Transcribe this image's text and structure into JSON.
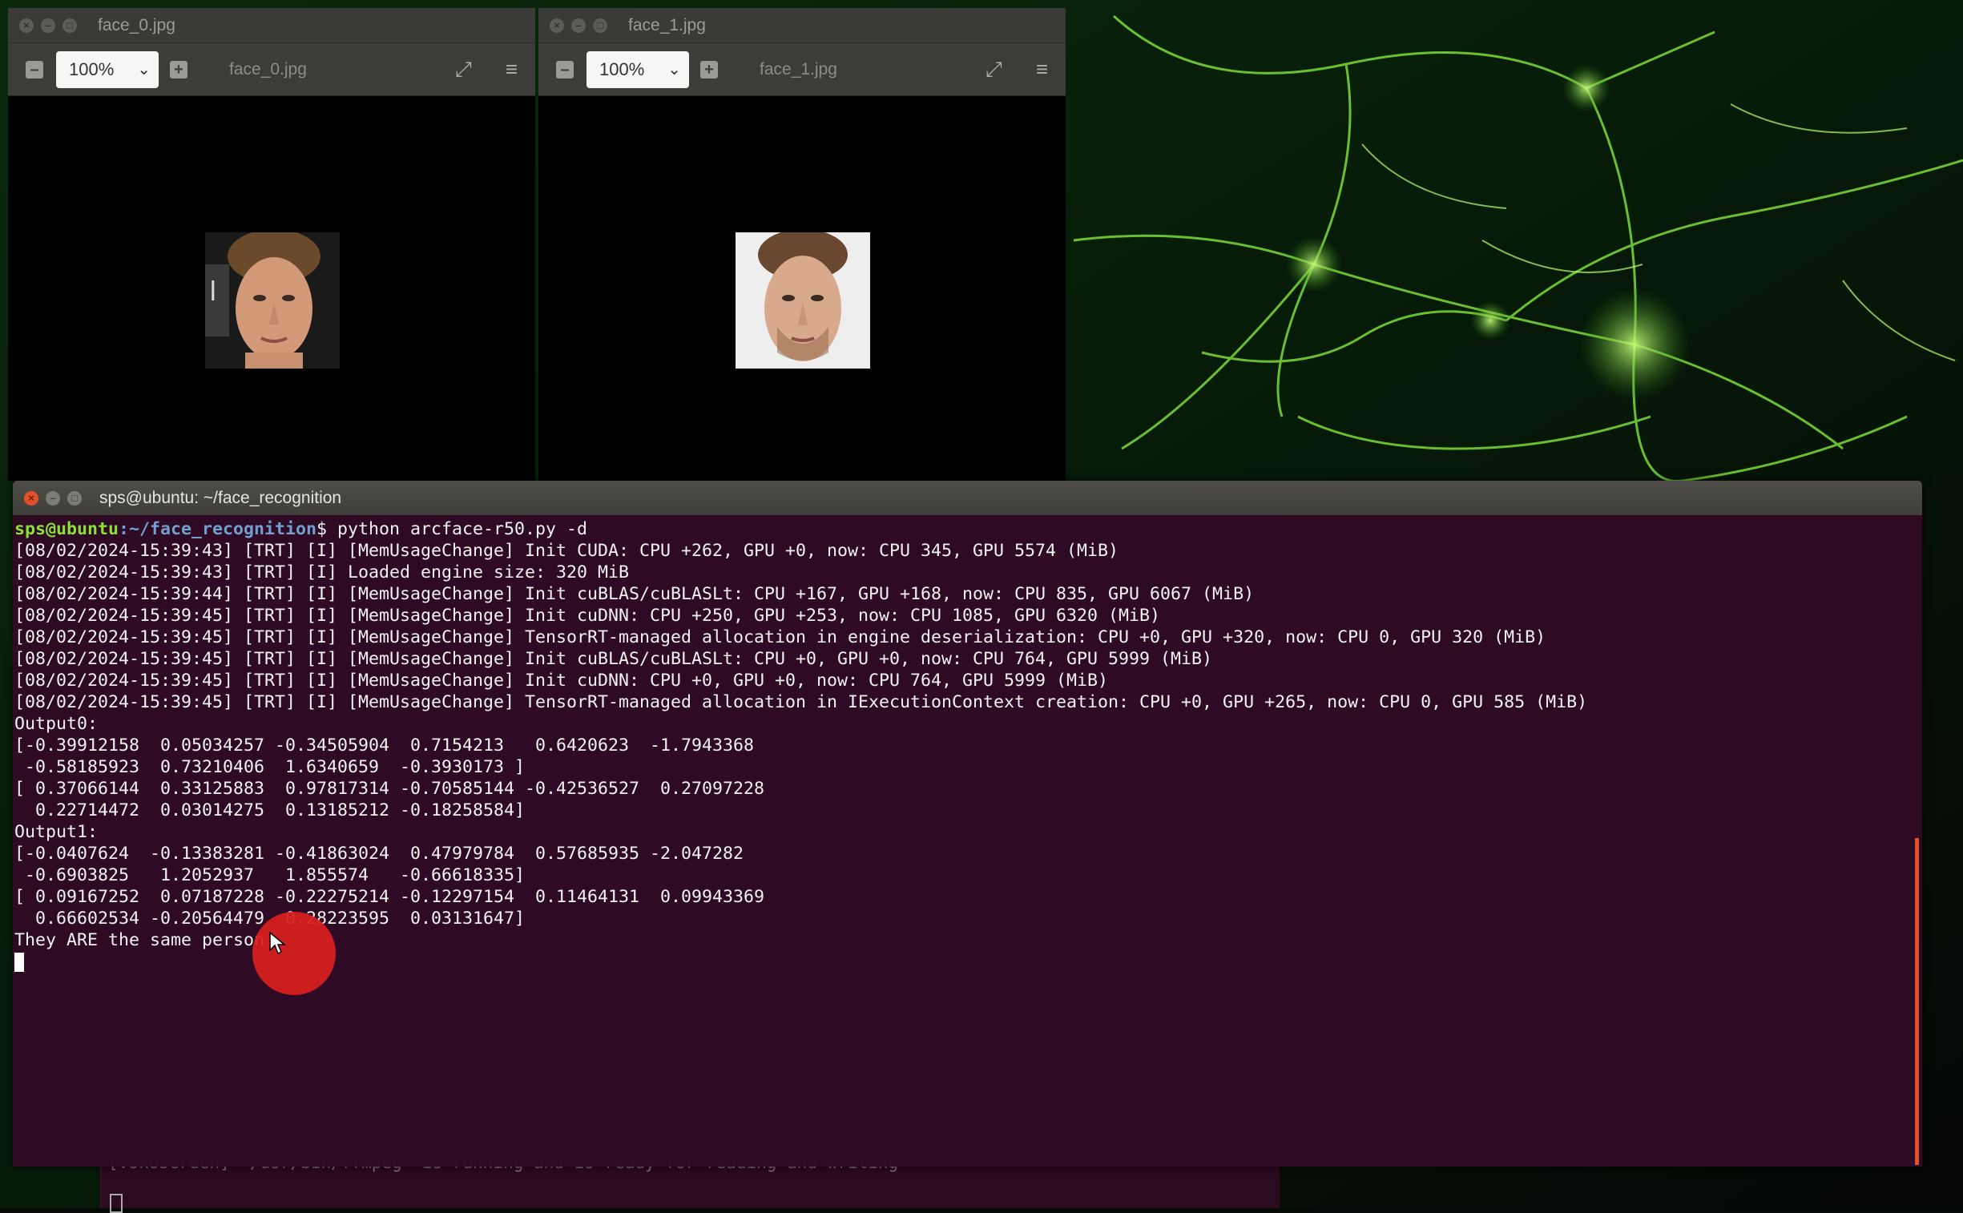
{
  "viewer_left": {
    "window_title": "face_0.jpg",
    "zoom_value": "100%",
    "file_label": "face_0.jpg",
    "zoom_out_icon": "zoom-out-icon",
    "zoom_in_icon": "zoom-in-icon",
    "fullscreen_icon": "fullscreen-icon",
    "menu_icon": "hamburger-menu-icon"
  },
  "viewer_right": {
    "window_title": "face_1.jpg",
    "zoom_value": "100%",
    "file_label": "face_1.jpg",
    "zoom_out_icon": "zoom-out-icon",
    "zoom_in_icon": "zoom-in-icon",
    "fullscreen_icon": "fullscreen-icon",
    "menu_icon": "hamburger-menu-icon"
  },
  "terminal": {
    "title": "sps@ubuntu: ~/face_recognition",
    "prompt_user": "sps@ubuntu",
    "prompt_path": ":~/face_recognition",
    "prompt_command": "$ python arcface-r50.py -d",
    "lines": [
      "[08/02/2024-15:39:43] [TRT] [I] [MemUsageChange] Init CUDA: CPU +262, GPU +0, now: CPU 345, GPU 5574 (MiB)",
      "[08/02/2024-15:39:43] [TRT] [I] Loaded engine size: 320 MiB",
      "[08/02/2024-15:39:44] [TRT] [I] [MemUsageChange] Init cuBLAS/cuBLASLt: CPU +167, GPU +168, now: CPU 835, GPU 6067 (MiB)",
      "[08/02/2024-15:39:45] [TRT] [I] [MemUsageChange] Init cuDNN: CPU +250, GPU +253, now: CPU 1085, GPU 6320 (MiB)",
      "[08/02/2024-15:39:45] [TRT] [I] [MemUsageChange] TensorRT-managed allocation in engine deserialization: CPU +0, GPU +320, now: CPU 0, GPU 320 (MiB)",
      "[08/02/2024-15:39:45] [TRT] [I] [MemUsageChange] Init cuBLAS/cuBLASLt: CPU +0, GPU +0, now: CPU 764, GPU 5999 (MiB)",
      "[08/02/2024-15:39:45] [TRT] [I] [MemUsageChange] Init cuDNN: CPU +0, GPU +0, now: CPU 764, GPU 5999 (MiB)",
      "[08/02/2024-15:39:45] [TRT] [I] [MemUsageChange] TensorRT-managed allocation in IExecutionContext creation: CPU +0, GPU +265, now: CPU 0, GPU 585 (MiB)",
      "Output0:",
      "[-0.39912158  0.05034257 -0.34505904  0.7154213   0.6420623  -1.7943368",
      " -0.58185923  0.73210406  1.6340659  -0.3930173 ]",
      "[ 0.37066144  0.33125883  0.97817314 -0.70585144 -0.42536527  0.27097228",
      "  0.22714472  0.03014275  0.13185212 -0.18258584]",
      "Output1:",
      "[-0.0407624  -0.13383281 -0.41863024  0.47979784  0.57685935 -2.047282",
      " -0.6903825   1.2052937   1.855574   -0.66618335]",
      "[ 0.09167252  0.07187228 -0.22275214 -0.12297154  0.11464131  0.09943369",
      "  0.66602534 -0.20564479  0.28223595  0.03131647]",
      "They ARE the same person."
    ]
  },
  "background_terminal": {
    "bottom_line": "[vokoscreen] \"/usr/bin/ffmpeg\" is running and is ready for reading and writing"
  }
}
